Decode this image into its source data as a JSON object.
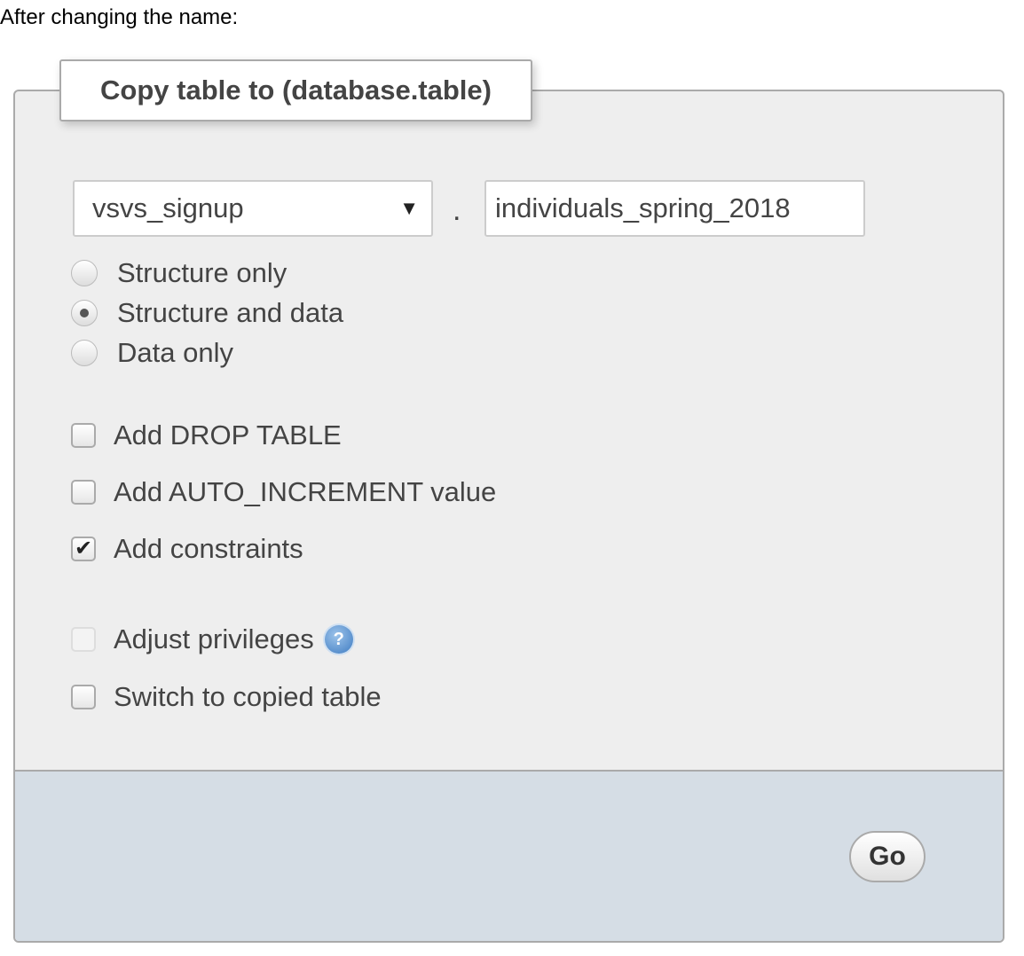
{
  "intro": "After changing the name:",
  "legend": "Copy table to (database.table)",
  "database_select": {
    "value": "vsvs_signup"
  },
  "separator": ".",
  "table_input": {
    "value": "individuals_spring_2018"
  },
  "radios": [
    {
      "label": "Structure only",
      "checked": false
    },
    {
      "label": "Structure and data",
      "checked": true
    },
    {
      "label": "Data only",
      "checked": false
    }
  ],
  "checkboxes": [
    {
      "label": "Add DROP TABLE",
      "checked": false
    },
    {
      "label": "Add AUTO_INCREMENT value",
      "checked": false
    },
    {
      "label": "Add constraints",
      "checked": true
    },
    {
      "label": "Adjust privileges",
      "checked": false,
      "disabled": true
    },
    {
      "label": "Switch to copied table",
      "checked": false
    }
  ],
  "go_label": "Go",
  "colors": {
    "footer": "#d5dde5",
    "panel": "#eeeeee"
  }
}
